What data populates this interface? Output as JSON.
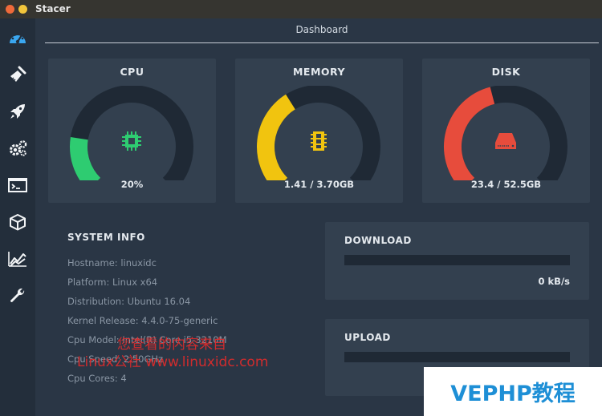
{
  "window": {
    "title": "Stacer"
  },
  "header": {
    "title": "Dashboard"
  },
  "sidebar": {
    "items": [
      {
        "name": "dashboard",
        "icon": "speedometer-icon"
      },
      {
        "name": "system-cleaner",
        "icon": "broom-icon"
      },
      {
        "name": "startup-apps",
        "icon": "rocket-icon"
      },
      {
        "name": "services",
        "icon": "gears-icon"
      },
      {
        "name": "processes",
        "icon": "terminal-icon"
      },
      {
        "name": "uninstaller",
        "icon": "package-box-icon"
      },
      {
        "name": "resources",
        "icon": "line-chart-icon"
      },
      {
        "name": "settings",
        "icon": "wrench-icon"
      }
    ]
  },
  "gauges": [
    {
      "title": "CPU",
      "value": "20%",
      "percent": 0.2,
      "color": "#2ecc71",
      "icon": "cpu-chip-icon"
    },
    {
      "title": "MEMORY",
      "value": "1.41 / 3.70GB",
      "percent": 0.381,
      "color": "#f1c40f",
      "icon": "memory-stick-icon"
    },
    {
      "title": "DISK",
      "value": "23.4 / 52.5GB",
      "percent": 0.446,
      "color": "#e74c3c",
      "icon": "hard-disk-icon"
    }
  ],
  "system_info": {
    "title": "SYSTEM INFO",
    "rows": [
      "Hostname: linuxidc",
      "Platform: Linux x64",
      "Distribution: Ubuntu 16.04",
      "Kernel Release: 4.4.0-75-generic",
      "Cpu Model: Intel(R) Core i5-3210M",
      "Cpu Speed: 2.50GHz",
      "Cpu Cores: 4"
    ]
  },
  "download": {
    "title": "DOWNLOAD",
    "rate": "0 kB/s",
    "fill": 0
  },
  "upload": {
    "title": "UPLOAD",
    "fill": 0
  },
  "watermark": {
    "line1": "您查看的内容来自",
    "line2": "Linux公社 www.linuxidc.com",
    "brand": "VEPHP教程"
  },
  "colors": {
    "track": "#1f2935",
    "card": "#33404f",
    "background": "#2a3645",
    "sidebar": "#232e3b"
  }
}
